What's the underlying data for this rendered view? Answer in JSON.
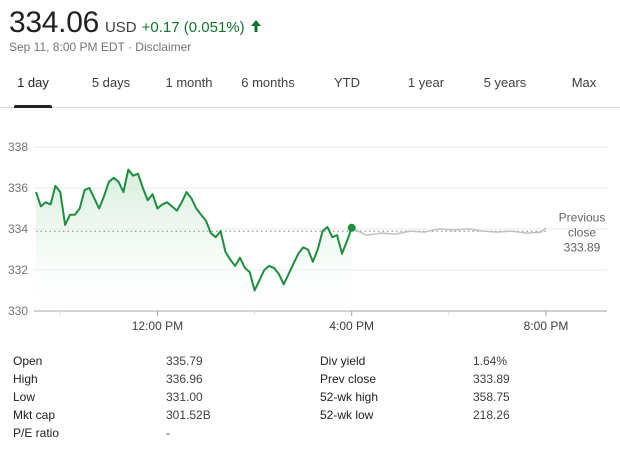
{
  "quote": {
    "price": "334.06",
    "currency": "USD",
    "change": "+0.17 (0.051%)",
    "timestamp": "Sep 11, 8:00 PM EDT",
    "separator": " · ",
    "disclaimer": "Disclaimer",
    "up_color": "#137333",
    "arrow_icon": "arrow-up-icon"
  },
  "tabs": [
    {
      "label": "1 day",
      "active": true
    },
    {
      "label": "5 days",
      "active": false
    },
    {
      "label": "1 month",
      "active": false
    },
    {
      "label": "6 months",
      "active": false
    },
    {
      "label": "YTD",
      "active": false
    },
    {
      "label": "1 year",
      "active": false
    },
    {
      "label": "5 years",
      "active": false
    },
    {
      "label": "Max",
      "active": false
    }
  ],
  "chart_data": {
    "type": "line",
    "y_ticks": [
      "338",
      "336",
      "334",
      "332",
      "330"
    ],
    "x_ticks": [
      "12:00 PM",
      "4:00 PM",
      "8:00 PM"
    ],
    "ylim": [
      330,
      338
    ],
    "previous_close": 333.89,
    "previous_close_label_line1": "Previous",
    "previous_close_label_line2": "close",
    "previous_close_value": "333.89",
    "colors": {
      "regular": "#1e8e3e",
      "after_hours": "#bdc1c6",
      "fill": "#e6f4ea"
    },
    "series": [
      {
        "session": "regular",
        "x_hours": [
          9.5,
          9.6,
          9.7,
          9.8,
          9.9,
          10.0,
          10.1,
          10.2,
          10.3,
          10.4,
          10.5,
          10.6,
          10.7,
          10.8,
          10.9,
          11.0,
          11.1,
          11.2,
          11.3,
          11.4,
          11.5,
          11.6,
          11.7,
          11.8,
          11.9,
          12.0,
          12.1,
          12.2,
          12.3,
          12.4,
          12.5,
          12.6,
          12.7,
          12.8,
          12.9,
          13.0,
          13.1,
          13.2,
          13.3,
          13.4,
          13.5,
          13.6,
          13.7,
          13.8,
          13.9,
          14.0,
          14.1,
          14.2,
          14.3,
          14.4,
          14.5,
          14.6,
          14.7,
          14.8,
          14.9,
          15.0,
          15.1,
          15.2,
          15.3,
          15.4,
          15.5,
          15.6,
          15.7,
          15.8,
          15.9,
          16.0
        ],
        "values": [
          335.8,
          335.1,
          335.3,
          335.2,
          336.1,
          335.8,
          334.2,
          334.7,
          334.7,
          335.0,
          335.9,
          336.0,
          335.5,
          335.0,
          335.6,
          336.3,
          336.5,
          336.3,
          335.8,
          336.9,
          336.6,
          336.7,
          336.0,
          335.4,
          335.7,
          335.0,
          335.2,
          335.3,
          335.1,
          334.9,
          335.3,
          335.8,
          335.5,
          335.0,
          334.7,
          334.4,
          333.8,
          333.6,
          333.9,
          332.9,
          332.5,
          332.2,
          332.6,
          332.1,
          331.9,
          331.0,
          331.5,
          332.0,
          332.2,
          332.1,
          331.8,
          331.3,
          331.8,
          332.3,
          332.8,
          333.1,
          333.0,
          332.4,
          333.0,
          333.9,
          334.1,
          333.6,
          333.7,
          332.8,
          333.4,
          334.06
        ]
      },
      {
        "session": "after_hours",
        "x_hours": [
          16.0,
          16.3,
          16.6,
          16.9,
          17.2,
          17.5,
          17.8,
          18.1,
          18.4,
          18.7,
          19.0,
          19.3,
          19.6,
          19.9,
          20.0
        ],
        "values": [
          334.06,
          333.7,
          333.8,
          333.75,
          333.9,
          333.85,
          334.0,
          333.95,
          334.0,
          333.9,
          333.85,
          333.9,
          333.8,
          333.85,
          334.06
        ]
      }
    ]
  },
  "stats": {
    "left": [
      {
        "label": "Open",
        "value": "335.79"
      },
      {
        "label": "High",
        "value": "336.96"
      },
      {
        "label": "Low",
        "value": "331.00"
      },
      {
        "label": "Mkt cap",
        "value": "301.52B"
      },
      {
        "label": "P/E ratio",
        "value": "-"
      }
    ],
    "right": [
      {
        "label": "Div yield",
        "value": "1.64%"
      },
      {
        "label": "Prev close",
        "value": "333.89"
      },
      {
        "label": "52-wk high",
        "value": "358.75"
      },
      {
        "label": "52-wk low",
        "value": "218.26"
      }
    ]
  }
}
